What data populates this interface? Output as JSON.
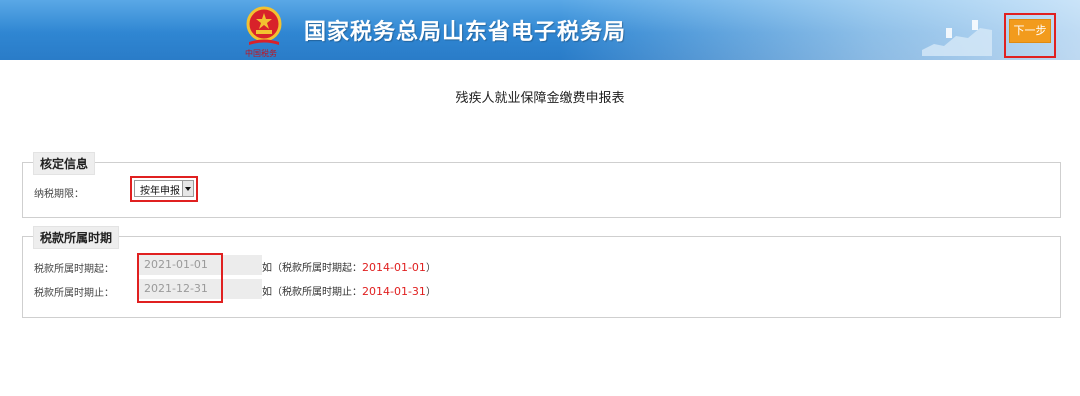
{
  "header": {
    "title": "国家税务总局山东省电子税务局",
    "next_button": "下一步",
    "colors": {
      "bar": "#2f86d2",
      "button": "#f29b1d",
      "highlight": "#e02020"
    }
  },
  "page": {
    "title": "残疾人就业保障金缴费申报表"
  },
  "section_verify": {
    "legend": "核定信息",
    "period_label": "纳税期限：",
    "period_value": "按年申报"
  },
  "section_period": {
    "legend": "税款所属时期",
    "start_label": "税款所属时期起：",
    "start_value": "2021-01-01",
    "start_hint_prefix": "如（税款所属时期起：",
    "start_hint_date": "2014-01-01",
    "start_hint_suffix": "）",
    "end_label": "税款所属时期止：",
    "end_value": "2021-12-31",
    "end_hint_prefix": "如（税款所属时期止：",
    "end_hint_date": "2014-01-31",
    "end_hint_suffix": "）"
  }
}
